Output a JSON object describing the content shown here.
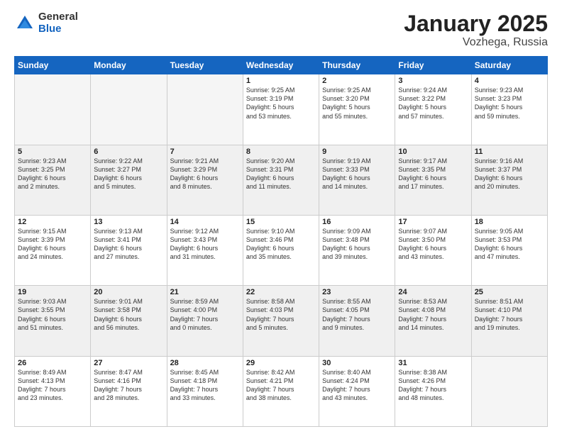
{
  "logo": {
    "general": "General",
    "blue": "Blue"
  },
  "header": {
    "month": "January 2025",
    "location": "Vozhega, Russia"
  },
  "weekdays": [
    "Sunday",
    "Monday",
    "Tuesday",
    "Wednesday",
    "Thursday",
    "Friday",
    "Saturday"
  ],
  "weeks": [
    [
      {
        "day": "",
        "info": ""
      },
      {
        "day": "",
        "info": ""
      },
      {
        "day": "",
        "info": ""
      },
      {
        "day": "1",
        "info": "Sunrise: 9:25 AM\nSunset: 3:19 PM\nDaylight: 5 hours\nand 53 minutes."
      },
      {
        "day": "2",
        "info": "Sunrise: 9:25 AM\nSunset: 3:20 PM\nDaylight: 5 hours\nand 55 minutes."
      },
      {
        "day": "3",
        "info": "Sunrise: 9:24 AM\nSunset: 3:22 PM\nDaylight: 5 hours\nand 57 minutes."
      },
      {
        "day": "4",
        "info": "Sunrise: 9:23 AM\nSunset: 3:23 PM\nDaylight: 5 hours\nand 59 minutes."
      }
    ],
    [
      {
        "day": "5",
        "info": "Sunrise: 9:23 AM\nSunset: 3:25 PM\nDaylight: 6 hours\nand 2 minutes."
      },
      {
        "day": "6",
        "info": "Sunrise: 9:22 AM\nSunset: 3:27 PM\nDaylight: 6 hours\nand 5 minutes."
      },
      {
        "day": "7",
        "info": "Sunrise: 9:21 AM\nSunset: 3:29 PM\nDaylight: 6 hours\nand 8 minutes."
      },
      {
        "day": "8",
        "info": "Sunrise: 9:20 AM\nSunset: 3:31 PM\nDaylight: 6 hours\nand 11 minutes."
      },
      {
        "day": "9",
        "info": "Sunrise: 9:19 AM\nSunset: 3:33 PM\nDaylight: 6 hours\nand 14 minutes."
      },
      {
        "day": "10",
        "info": "Sunrise: 9:17 AM\nSunset: 3:35 PM\nDaylight: 6 hours\nand 17 minutes."
      },
      {
        "day": "11",
        "info": "Sunrise: 9:16 AM\nSunset: 3:37 PM\nDaylight: 6 hours\nand 20 minutes."
      }
    ],
    [
      {
        "day": "12",
        "info": "Sunrise: 9:15 AM\nSunset: 3:39 PM\nDaylight: 6 hours\nand 24 minutes."
      },
      {
        "day": "13",
        "info": "Sunrise: 9:13 AM\nSunset: 3:41 PM\nDaylight: 6 hours\nand 27 minutes."
      },
      {
        "day": "14",
        "info": "Sunrise: 9:12 AM\nSunset: 3:43 PM\nDaylight: 6 hours\nand 31 minutes."
      },
      {
        "day": "15",
        "info": "Sunrise: 9:10 AM\nSunset: 3:46 PM\nDaylight: 6 hours\nand 35 minutes."
      },
      {
        "day": "16",
        "info": "Sunrise: 9:09 AM\nSunset: 3:48 PM\nDaylight: 6 hours\nand 39 minutes."
      },
      {
        "day": "17",
        "info": "Sunrise: 9:07 AM\nSunset: 3:50 PM\nDaylight: 6 hours\nand 43 minutes."
      },
      {
        "day": "18",
        "info": "Sunrise: 9:05 AM\nSunset: 3:53 PM\nDaylight: 6 hours\nand 47 minutes."
      }
    ],
    [
      {
        "day": "19",
        "info": "Sunrise: 9:03 AM\nSunset: 3:55 PM\nDaylight: 6 hours\nand 51 minutes."
      },
      {
        "day": "20",
        "info": "Sunrise: 9:01 AM\nSunset: 3:58 PM\nDaylight: 6 hours\nand 56 minutes."
      },
      {
        "day": "21",
        "info": "Sunrise: 8:59 AM\nSunset: 4:00 PM\nDaylight: 7 hours\nand 0 minutes."
      },
      {
        "day": "22",
        "info": "Sunrise: 8:58 AM\nSunset: 4:03 PM\nDaylight: 7 hours\nand 5 minutes."
      },
      {
        "day": "23",
        "info": "Sunrise: 8:55 AM\nSunset: 4:05 PM\nDaylight: 7 hours\nand 9 minutes."
      },
      {
        "day": "24",
        "info": "Sunrise: 8:53 AM\nSunset: 4:08 PM\nDaylight: 7 hours\nand 14 minutes."
      },
      {
        "day": "25",
        "info": "Sunrise: 8:51 AM\nSunset: 4:10 PM\nDaylight: 7 hours\nand 19 minutes."
      }
    ],
    [
      {
        "day": "26",
        "info": "Sunrise: 8:49 AM\nSunset: 4:13 PM\nDaylight: 7 hours\nand 23 minutes."
      },
      {
        "day": "27",
        "info": "Sunrise: 8:47 AM\nSunset: 4:16 PM\nDaylight: 7 hours\nand 28 minutes."
      },
      {
        "day": "28",
        "info": "Sunrise: 8:45 AM\nSunset: 4:18 PM\nDaylight: 7 hours\nand 33 minutes."
      },
      {
        "day": "29",
        "info": "Sunrise: 8:42 AM\nSunset: 4:21 PM\nDaylight: 7 hours\nand 38 minutes."
      },
      {
        "day": "30",
        "info": "Sunrise: 8:40 AM\nSunset: 4:24 PM\nDaylight: 7 hours\nand 43 minutes."
      },
      {
        "day": "31",
        "info": "Sunrise: 8:38 AM\nSunset: 4:26 PM\nDaylight: 7 hours\nand 48 minutes."
      },
      {
        "day": "",
        "info": ""
      }
    ]
  ]
}
